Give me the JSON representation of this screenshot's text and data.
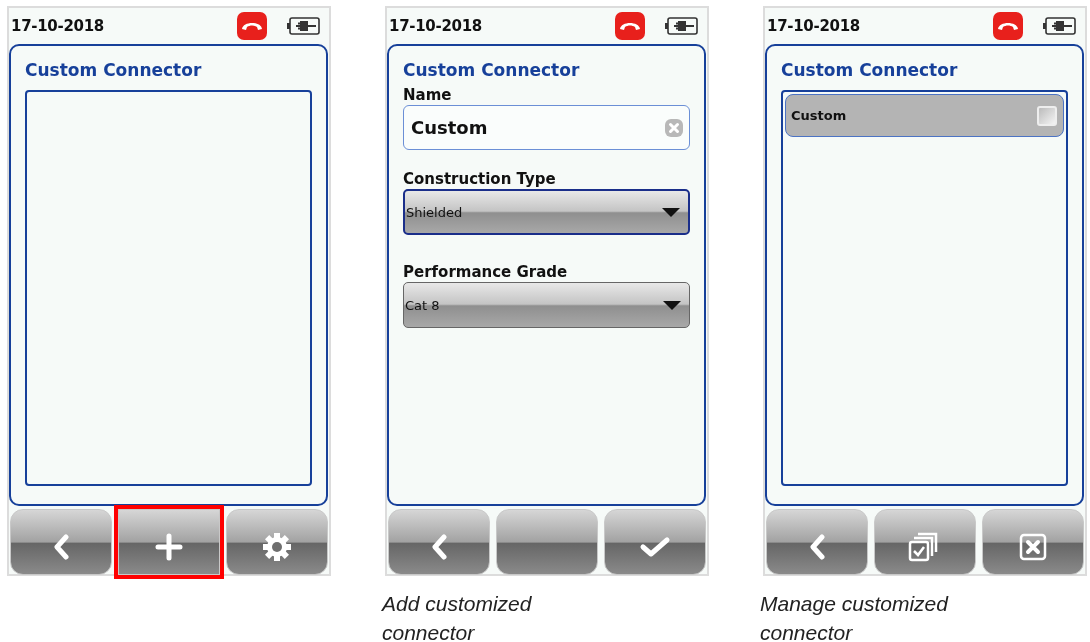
{
  "screens": [
    {
      "date": "17-10-2018",
      "title": "Custom Connector",
      "kind": "list",
      "buttons": [
        {
          "kind": "back",
          "highlighted": false
        },
        {
          "kind": "plus",
          "highlighted": true
        },
        {
          "kind": "gear",
          "highlighted": false
        }
      ]
    },
    {
      "date": "17-10-2018",
      "title": "Custom Connector",
      "kind": "form",
      "fields": [
        {
          "kind": "text",
          "label": "Name",
          "value": "Custom"
        },
        {
          "kind": "dropdown",
          "label": "Construction Type",
          "value": "Shielded",
          "focused": true
        },
        {
          "kind": "dropdown",
          "label": "Performance Grade",
          "value": "Cat 8",
          "focused": false
        }
      ],
      "buttons": [
        {
          "kind": "back",
          "highlighted": false
        },
        {
          "kind": "blank",
          "highlighted": false
        },
        {
          "kind": "check",
          "highlighted": false
        }
      ],
      "caption": "Add customized connector"
    },
    {
      "date": "17-10-2018",
      "title": "Custom Connector",
      "kind": "list",
      "items": [
        {
          "label": "Custom",
          "checked": false
        }
      ],
      "buttons": [
        {
          "kind": "back",
          "highlighted": false
        },
        {
          "kind": "selectall",
          "highlighted": false
        },
        {
          "kind": "delete",
          "highlighted": false
        }
      ],
      "caption": "Manage customized connector"
    }
  ]
}
